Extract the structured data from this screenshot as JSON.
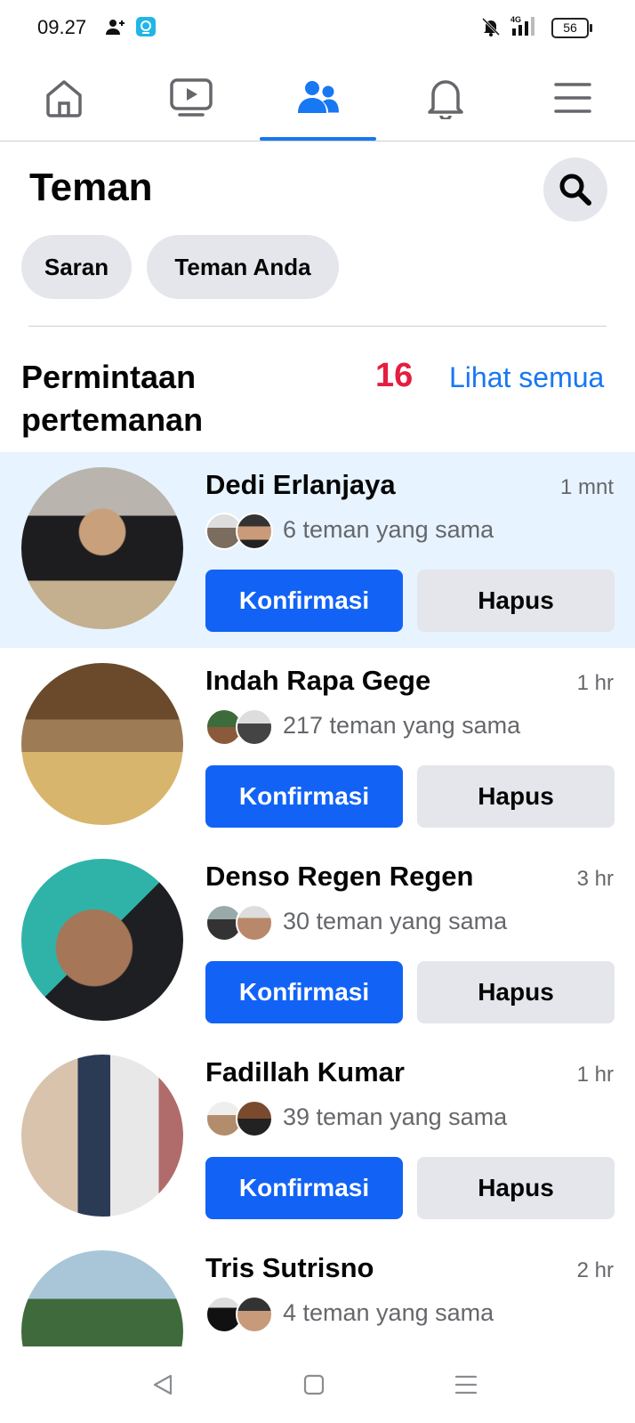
{
  "status_bar": {
    "time": "09.27",
    "network": "4G",
    "battery": "56"
  },
  "nav": {
    "tabs": [
      {
        "name": "home-icon"
      },
      {
        "name": "video-icon"
      },
      {
        "name": "friends-icon",
        "active": true
      },
      {
        "name": "bell-icon"
      },
      {
        "name": "menu-icon"
      }
    ],
    "accent": "#1877f2"
  },
  "header": {
    "title": "Teman",
    "chips": [
      "Saran",
      "Teman Anda"
    ]
  },
  "requests_section": {
    "title": "Permintaan pertemanan",
    "count": "16",
    "see_all": "Lihat semua",
    "confirm_label": "Konfirmasi",
    "delete_label": "Hapus",
    "items": [
      {
        "name": "Dedi Erlanjaya",
        "time": "1 mnt",
        "mutual": "6 teman yang sama"
      },
      {
        "name": "Indah Rapa Gege",
        "time": "1 hr",
        "mutual": "217 teman yang sama"
      },
      {
        "name": "Denso Regen Regen",
        "time": "3 hr",
        "mutual": "30 teman yang sama"
      },
      {
        "name": "Fadillah Kumar",
        "time": "1 hr",
        "mutual": "39 teman yang sama"
      },
      {
        "name": "Tris Sutrisno",
        "time": "2 hr",
        "mutual": "4 teman yang sama"
      }
    ]
  },
  "colors": {
    "confirm": "#1263f5",
    "count": "#e41e3f",
    "highlight": "#e7f3ff"
  }
}
